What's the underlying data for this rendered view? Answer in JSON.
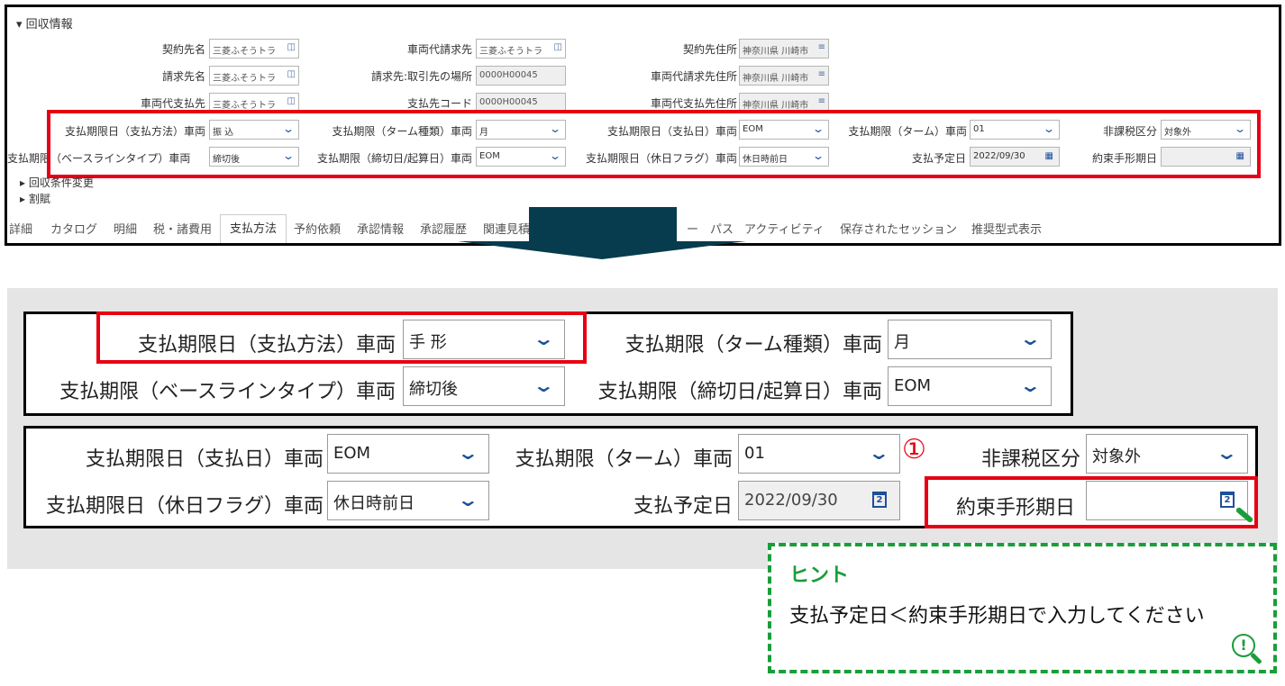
{
  "top": {
    "section_title": "回収情報",
    "rows": {
      "contract_name_label": "契約先名",
      "contract_name_value": "三菱ふそうトラ",
      "vehicle_bill_label": "車両代請求先",
      "vehicle_bill_value": "三菱ふそうトラ",
      "contract_addr_label": "契約先住所",
      "contract_addr_value": "神奈川県 川崎市",
      "bill_name_label": "請求先名",
      "bill_name_value": "三菱ふそうトラ",
      "bill_place_label": "請求先:取引先の場所",
      "bill_place_value": "0000H00045",
      "vehicle_bill_addr_label": "車両代請求先住所",
      "vehicle_bill_addr_value": "神奈川県 川崎市",
      "vehicle_payee_label": "車両代支払先",
      "vehicle_payee_value": "三菱ふそうトラ",
      "payee_code_label": "支払先コード",
      "payee_code_value": "0000H00045",
      "vehicle_payee_addr_label": "車両代支払先住所",
      "vehicle_payee_addr_value": "神奈川県 川崎市"
    },
    "payment": {
      "method_label": "支払期限日（支払方法）車両",
      "method_value": "振 込",
      "term_type_label": "支払期限（ターム種類）車両",
      "term_type_value": "月",
      "pay_day_label": "支払期限日（支払日）車両",
      "pay_day_value": "EOM",
      "term_label": "支払期限（ターム）車両",
      "term_value": "01",
      "tax_label": "非課税区分",
      "tax_value": "対象外",
      "baseline_label": "支払期限（ベースラインタイプ）車両",
      "baseline_value": "締切後",
      "cutoff_label": "支払期限（締切日/起算日）車両",
      "cutoff_value": "EOM",
      "holiday_label": "支払期限日（休日フラグ）車両",
      "holiday_value": "休日時前日",
      "scheduled_label": "支払予定日",
      "scheduled_value": "2022/09/30",
      "promissory_label": "約束手形期日",
      "promissory_value": ""
    },
    "collapsed_sections": [
      "回収条件変更",
      "割賦"
    ],
    "tabs": [
      "詳細",
      "カタログ",
      "明細",
      "税・諸費用",
      "支払方法",
      "予約依頼",
      "承認情報",
      "承認履歴",
      "関連見積",
      "パス",
      "アクティビティ",
      "保存されたセッション",
      "推奨型式表示"
    ],
    "active_tab": "支払方法",
    "tab_fragment": "ー"
  },
  "bottom": {
    "method_label": "支払期限日（支払方法）車両",
    "method_value": "手 形",
    "term_type_label": "支払期限（ターム種類）車両",
    "term_type_value": "月",
    "baseline_label": "支払期限（ベースラインタイプ）車両",
    "baseline_value": "締切後",
    "cutoff_label": "支払期限（締切日/起算日）車両",
    "cutoff_value": "EOM",
    "pay_day_label": "支払期限日（支払日）車両",
    "pay_day_value": "EOM",
    "term_label": "支払期限（ターム）車両",
    "term_value": "01",
    "tax_label": "非課税区分",
    "tax_value": "対象外",
    "holiday_label": "支払期限日（休日フラグ）車両",
    "holiday_value": "休日時前日",
    "scheduled_label": "支払予定日",
    "scheduled_value": "2022/09/30",
    "promissory_label": "約束手形期日",
    "promissory_value": "",
    "step_marker": "①"
  },
  "hint": {
    "title": "ヒント",
    "text": "支払予定日＜約束手形期日で入力してください"
  },
  "colors": {
    "highlight_red": "#e60012",
    "hint_green": "#1a9e3a",
    "arrow": "#063c4d",
    "chevron_blue": "#1d4f9a"
  }
}
